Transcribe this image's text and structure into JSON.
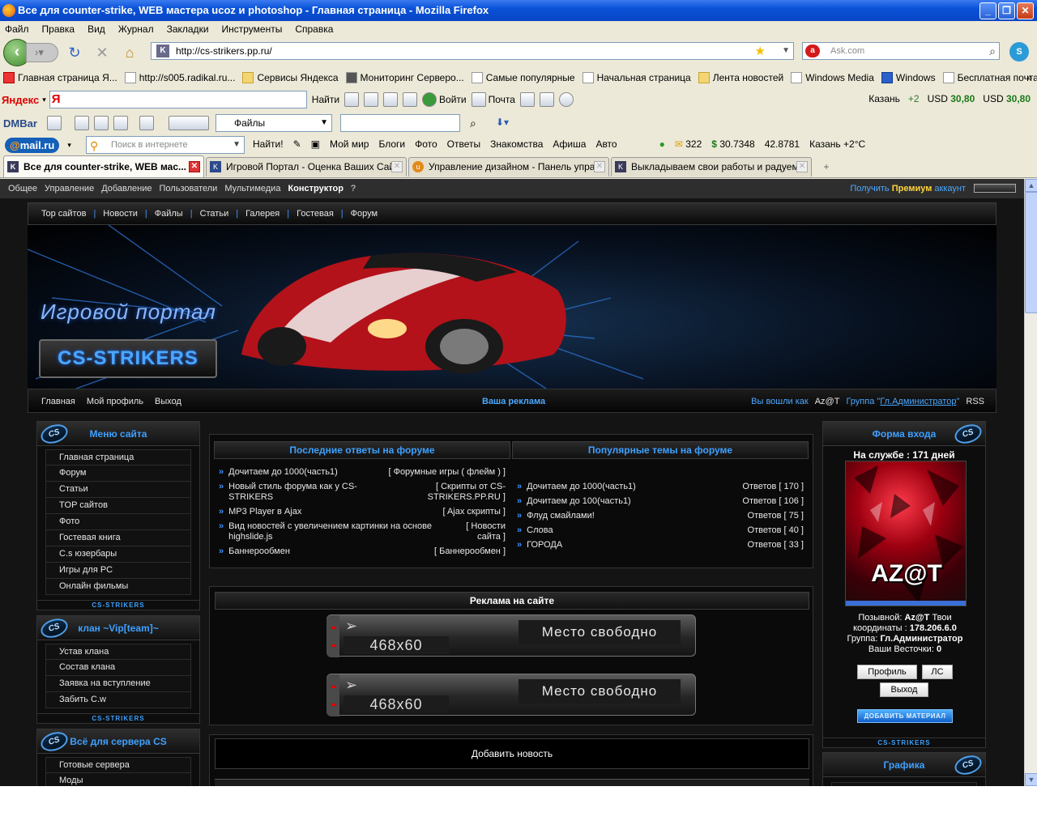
{
  "window": {
    "title": "Все для counter-strike, WEB мастера ucoz и photoshop - Главная страница - Mozilla Firefox"
  },
  "menubar": [
    "Файл",
    "Правка",
    "Вид",
    "Журнал",
    "Закладки",
    "Инструменты",
    "Справка"
  ],
  "nav": {
    "url": "http://cs-strikers.pp.ru/",
    "search_placeholder": "Ask.com"
  },
  "bookmarks": [
    "Главная страница Я...",
    "http://s005.radikal.ru...",
    "Сервисы Яндекса",
    "Мониторинг Серверо...",
    "Самые популярные",
    "Начальная страница",
    "Лента новостей",
    "Windows Media",
    "Windows",
    "Бесплатная почта Н..."
  ],
  "yandex": {
    "logo": "Яндекс",
    "find": "Найти",
    "enter": "Войти",
    "mail": "Почта",
    "city": "Казань",
    "temp": "+2",
    "usd1_label": "USD",
    "usd1": "30,80",
    "usd2_label": "USD",
    "usd2": "30,80"
  },
  "dmbar": {
    "logo": "DMBar",
    "select": "Файлы"
  },
  "mailru": {
    "logo": "@mail.ru",
    "search_placeholder": "Поиск в интернете",
    "find": "Найти!",
    "items": [
      "Мой мир",
      "Блоги",
      "Фото",
      "Ответы",
      "Знакомства",
      "Афиша",
      "Авто"
    ],
    "count": "322",
    "dollar": "30.7348",
    "euro": "42.8781",
    "weather": "Казань +2°C"
  },
  "tabs": [
    "Все для counter-strike, WEB мас...",
    "Игровой Портал - Оценка Ваших Сай...",
    "Управление дизайном - Панель упра...",
    "Выкладываем свои работы и радуем..."
  ],
  "ucoz": {
    "items": [
      "Общее",
      "Управление",
      "Добавление",
      "Пользователи",
      "Мультимедиа",
      "Конструктор",
      "?"
    ],
    "premium_pre": "Получить",
    "premium": "Премиум",
    "premium_post": "аккаунт"
  },
  "topnav": [
    "Top сайтов",
    "Новости",
    "Файлы",
    "Статьи",
    "Галерея",
    "Гостевая",
    "Форум"
  ],
  "banner": {
    "portal": "Игровой портал",
    "logo": "CS-STRIKERS"
  },
  "subnav": {
    "left": [
      "Главная",
      "Мой профиль",
      "Выход"
    ],
    "center": "Ваша реклама",
    "logged": "Вы вошли как",
    "user": "Az@T",
    "group_pre": "Группа \"",
    "group": "Гл.Администратор",
    "group_post": "\"",
    "rss": "RSS"
  },
  "site_menu": {
    "title": "Меню сайта",
    "items": [
      "Главная страница",
      "Форум",
      "Статьи",
      "TOP сайтов",
      "Фото",
      "Гостевая книга",
      "C.s юзербары",
      "Игры для PC",
      "Онлайн фильмы"
    ],
    "footer": "CS-STRIKERS"
  },
  "clan": {
    "title": "клан ~Vip[team]~",
    "items": [
      "Устав клана",
      "Состав клана",
      "Заявка на вступление",
      "Забить C.w"
    ],
    "footer": "CS-STRIKERS"
  },
  "server": {
    "title": "Всё для сервера CS",
    "items": [
      "Готовые сервера",
      "Моды"
    ]
  },
  "forum_latest": {
    "title": "Последние ответы на форуме",
    "rows": [
      {
        "text": "Дочитаем до 1000(часть1)",
        "cat": "[ Форумные игры ( флейм ) ]"
      },
      {
        "text": "Новый стиль форума как у CS-STRIKERS",
        "cat": "[ Скрипты от CS-STRIKERS.PP.RU ]"
      },
      {
        "text": "MP3 Player в Ajax",
        "cat": "[ Ajax скрипты ]"
      },
      {
        "text": "Вид новостей с увеличением картинки на основе highslide.js",
        "cat": "[ Новости сайта ]"
      },
      {
        "text": "Баннерообмен",
        "cat": "[ Баннерообмен ]"
      }
    ]
  },
  "forum_popular": {
    "title": "Популярные темы на форуме",
    "rows": [
      {
        "text": "Дочитаем до 1000(часть1)",
        "cat": "Ответов [ 170 ]"
      },
      {
        "text": "Дочитаем до 100(часть1)",
        "cat": "Ответов [ 106 ]"
      },
      {
        "text": "Флуд смайлами!",
        "cat": "Ответов [ 75 ]"
      },
      {
        "text": "Слова",
        "cat": "Ответов [ 40 ]"
      },
      {
        "text": "ГОРОДА",
        "cat": "Ответов [ 33 ]"
      }
    ]
  },
  "ads": {
    "title": "Реклама на сайте",
    "size": "468x60",
    "free": "Место свободно"
  },
  "news": {
    "add": "Добавить новость"
  },
  "login": {
    "title": "Форма входа",
    "duty": "На службе : 171 дней",
    "avatar_name": "AZ@T",
    "callsign_label": "Позывной:",
    "callsign": "Az@T",
    "callsign_suffix": "Твои",
    "coords_label": "координаты :",
    "coords": "178.206.6.0",
    "group_label": "Группа:",
    "group": "Гл.Администратор",
    "msgs_label": "Ваши Весточки:",
    "msgs": "0",
    "profile": "Профиль",
    "pm": "ЛС",
    "logout": "Выход",
    "add_material": "ДОБАВИТЬ МАТЕРИАЛ",
    "footer": "CS-STRIKERS"
  },
  "graphics": {
    "title": "Графика"
  }
}
